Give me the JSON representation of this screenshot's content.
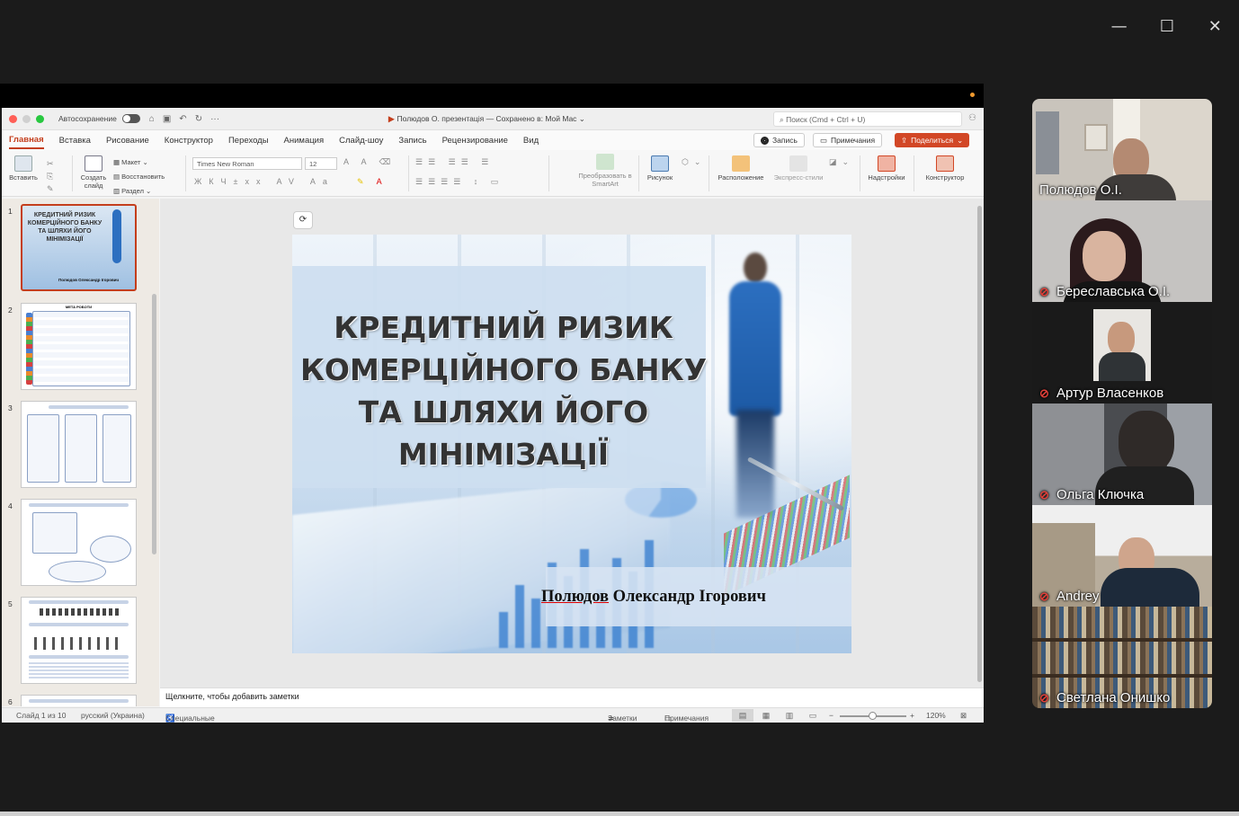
{
  "window_controls": {
    "minimize": "—",
    "maximize": "☐",
    "close": "✕"
  },
  "ppt": {
    "autosave_label": "Автосохранение",
    "doc_title": "Полюдов О. презентація — Сохранено в: Мой Mac ⌄",
    "search_placeholder": "Поиск (Cmd + Ctrl + U)",
    "tabs": [
      "Главная",
      "Вставка",
      "Рисование",
      "Конструктор",
      "Переходы",
      "Анимация",
      "Слайд-шоу",
      "Запись",
      "Рецензирование",
      "Вид"
    ],
    "record_label": "Запись",
    "comments_label": "Примечания",
    "share_label": "Поделиться",
    "ribbon": {
      "paste": "Вставить",
      "new_slide": "Создать слайд",
      "layout": "Макет",
      "reset": "Восстановить",
      "section": "Раздел",
      "font_name": "Times New Roman",
      "font_size": "12",
      "smartart": "Преобразовать в SmartArt",
      "picture": "Рисунок",
      "arrange": "Расположение",
      "quick_styles": "Экспресс-стили",
      "addins": "Надстройки",
      "designer": "Конструктор"
    },
    "slide_numbers": [
      "1",
      "2",
      "3",
      "4",
      "5",
      "6"
    ],
    "slide1_thumb_title": "КРЕДИТНИЙ РИЗИК КОМЕРЦІЙНОГО БАНКУ ТА ШЛЯХИ ЙОГО МІНІМІЗАЦІЇ",
    "slide1_thumb_author": "Полюдов Олександр Ігорович",
    "slide2_thumb_title": "МЕТА РОБОТИ",
    "slide": {
      "title_line1": "КРЕДИТНИЙ РИЗИК",
      "title_line2": "КОМЕРЦІЙНОГО БАНКУ",
      "title_line3": "ТА ШЛЯХИ ЙОГО",
      "title_line4": "МІНІМІЗАЦІЇ",
      "author_surname": "Полюдов",
      "author_rest": " Олександр Ігорович"
    },
    "notes_placeholder": "Щелкните, чтобы добавить заметки",
    "status": {
      "slide_counter": "Слайд 1 из 10",
      "language": "русский (Украина)",
      "accessibility": "Специальные возможности: проверьте рекомендации",
      "notes": "Заметки",
      "comments": "Примечания",
      "zoom": "120%"
    }
  },
  "participants": [
    {
      "name": "Полюдов О.І.",
      "muted": false,
      "active": false
    },
    {
      "name": "Береславська О.І.",
      "muted": true,
      "active": false
    },
    {
      "name": "Артур Власенков",
      "muted": true,
      "active": false
    },
    {
      "name": "Ольга Ключка",
      "muted": true,
      "active": true
    },
    {
      "name": "Andrey",
      "muted": true,
      "active": false
    },
    {
      "name": "Светлана Онишко",
      "muted": true,
      "active": false
    }
  ],
  "icons": {
    "mic_muted": "mic-muted-icon",
    "record": "record-icon",
    "comment": "comment-icon",
    "share": "share-icon",
    "search": "search-icon"
  },
  "colors": {
    "ppt_accent": "#c43e1c",
    "share_button": "#d24726",
    "active_speaker": "#2fd07a",
    "muted_mic": "#e0413a"
  }
}
